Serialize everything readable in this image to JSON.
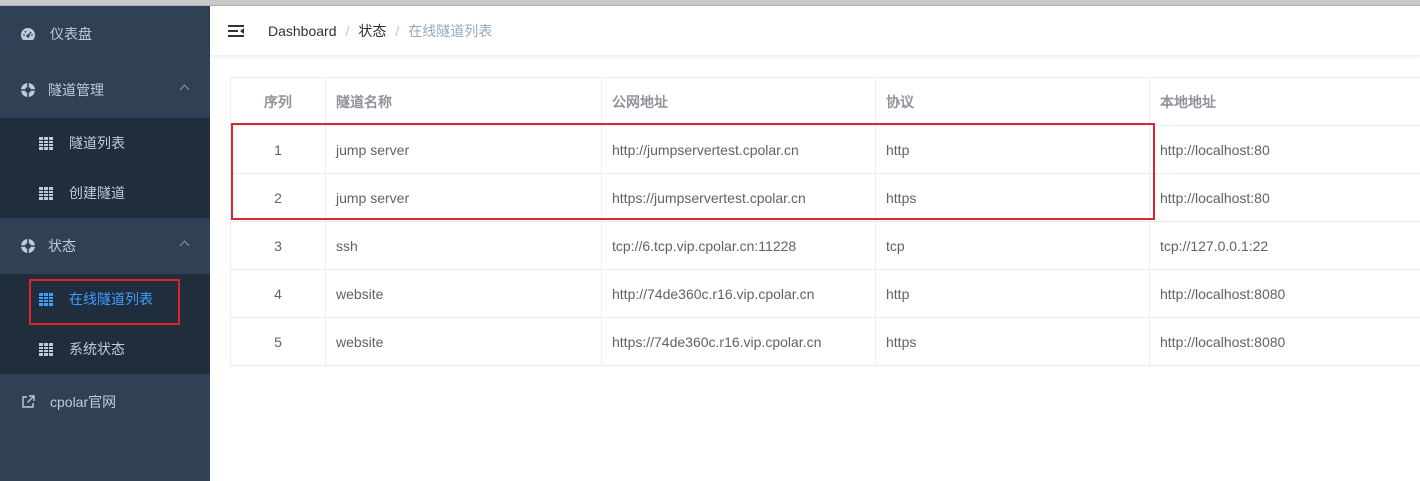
{
  "sidebar": {
    "dashboard": "仪表盘",
    "tunnel_management": "隧道管理",
    "tunnel_list": "隧道列表",
    "create_tunnel": "创建隧道",
    "status": "状态",
    "online_tunnels": "在线隧道列表",
    "system_status": "系统状态",
    "official_site": "cpolar官网"
  },
  "breadcrumb": {
    "home": "Dashboard",
    "parent": "状态",
    "current": "在线隧道列表",
    "separator": "/"
  },
  "table": {
    "headers": [
      "序列",
      "隧道名称",
      "公网地址",
      "协议",
      "本地地址"
    ],
    "rows": [
      [
        "1",
        "jump server",
        "http://jumpservertest.cpolar.cn",
        "http",
        "http://localhost:80"
      ],
      [
        "2",
        "jump server",
        "https://jumpservertest.cpolar.cn",
        "https",
        "http://localhost:80"
      ],
      [
        "3",
        "ssh",
        "tcp://6.tcp.vip.cpolar.cn:11228",
        "tcp",
        "tcp://127.0.0.1:22"
      ],
      [
        "4",
        "website",
        "http://74de360c.r16.vip.cpolar.cn",
        "http",
        "http://localhost:8080"
      ],
      [
        "5",
        "website",
        "https://74de360c.r16.vip.cpolar.cn",
        "https",
        "http://localhost:8080"
      ]
    ]
  },
  "colors": {
    "sidebar_bg": "#304156",
    "submenu_bg": "#1f2d3d",
    "active": "#409eff",
    "highlight": "#d9252b"
  }
}
